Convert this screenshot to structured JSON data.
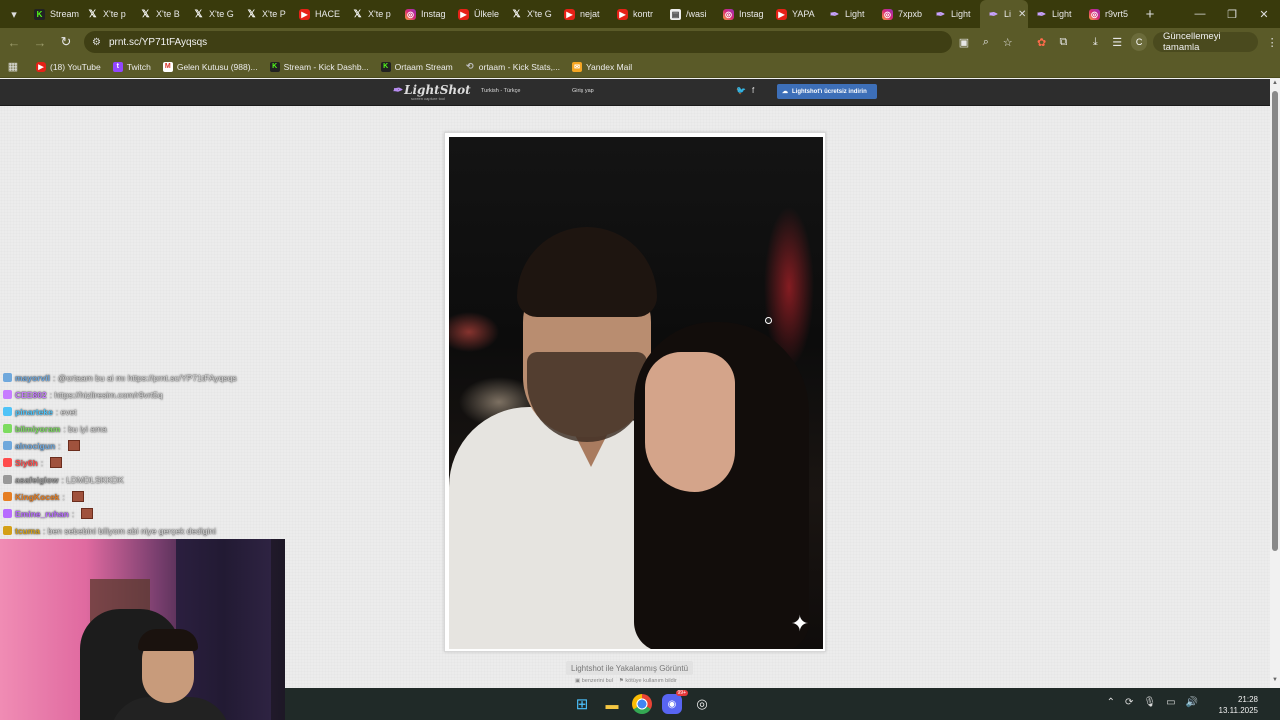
{
  "tabs": [
    {
      "icon": "kick",
      "label": "Stream"
    },
    {
      "icon": "x",
      "label": "X'te p"
    },
    {
      "icon": "x",
      "label": "X'te B"
    },
    {
      "icon": "x",
      "label": "X'te G"
    },
    {
      "icon": "x",
      "label": "X'te P"
    },
    {
      "icon": "yt",
      "label": "HACE"
    },
    {
      "icon": "x",
      "label": "X'te p"
    },
    {
      "icon": "ig",
      "label": "Instag"
    },
    {
      "icon": "yt",
      "label": "Ülkele"
    },
    {
      "icon": "x",
      "label": "X'te G"
    },
    {
      "icon": "yt",
      "label": "nejat"
    },
    {
      "icon": "yt",
      "label": "kontr"
    },
    {
      "icon": "doc",
      "label": "/wasi"
    },
    {
      "icon": "ig",
      "label": "Instag"
    },
    {
      "icon": "yt",
      "label": "YAPA"
    },
    {
      "icon": "ls",
      "label": "Light"
    },
    {
      "icon": "ig",
      "label": "7xpxb"
    },
    {
      "icon": "ls",
      "label": "Light"
    },
    {
      "icon": "ls",
      "label": "Li",
      "active": true
    },
    {
      "icon": "ls",
      "label": "Light"
    },
    {
      "icon": "ig",
      "label": "r9vrt5"
    }
  ],
  "address_bar": {
    "url": "prnt.sc/YP71tFAyqsqs"
  },
  "update_button": "Güncellemeyi tamamla",
  "profile_initial": "C",
  "bookmarks": [
    {
      "icon": "yt",
      "label": "(18) YouTube"
    },
    {
      "icon": "tw",
      "label": "Twitch"
    },
    {
      "icon": "gm",
      "label": "Gelen Kutusu (988)..."
    },
    {
      "icon": "kk",
      "label": "Stream - Kick Dashb..."
    },
    {
      "icon": "kk",
      "label": "Ortaam Stream"
    },
    {
      "icon": "ot",
      "label": "ortaam - Kick Stats,..."
    },
    {
      "icon": "ym",
      "label": "Yandex Mail"
    }
  ],
  "lightshot": {
    "logo": "LightShot",
    "tagline": "screen capture tool",
    "language": "Turkish - Türkçe",
    "login": "Giriş yap",
    "download": "Lightshot'ı ücretsiz indirin",
    "caption": "Lightshot ile Yakalanmış Görüntü",
    "similar": "benzerini bul",
    "report": "kötüye kullanım bildir"
  },
  "chat": [
    {
      "user": "",
      "text": "",
      "color": "#9aa",
      "faded": true
    },
    {
      "user": "mayorvil",
      "text": " : @ortaam bu ai mı https://prnt.sc/YP71tFAyqsqs",
      "color": "#6fa8dc"
    },
    {
      "user": "CEE802",
      "text": " : https://hizliresim.com/r9vrt5q",
      "color": "#c77dff"
    },
    {
      "user": "pinarteke",
      "text": " : evet",
      "color": "#4fc3f7"
    },
    {
      "user": "bilmiyoram",
      "text": " : bu iyi ama",
      "color": "#7ddc5f"
    },
    {
      "user": "alnocigun",
      "text": " : ",
      "color": "#6fa8dc",
      "emote": true
    },
    {
      "user": "Siy6h",
      "text": " : ",
      "color": "#ff4d4d",
      "emote": true
    },
    {
      "user": "asafeiglow",
      "text": " : LDMDLSKKDK",
      "color": "#999"
    },
    {
      "user": "KingKocek",
      "text": " : ",
      "color": "#e67e22",
      "emote": true
    },
    {
      "user": "Emine_ruhan",
      "text": " : ",
      "color": "#b86bff",
      "emote": true
    },
    {
      "user": "tcuma",
      "text": " : ben sebebini biliyom abi niye gerçek dedigini",
      "color": "#d4a017"
    }
  ],
  "clock": {
    "time": "21:28",
    "date": "13.11.2025"
  },
  "taskbar_badge": "99+"
}
